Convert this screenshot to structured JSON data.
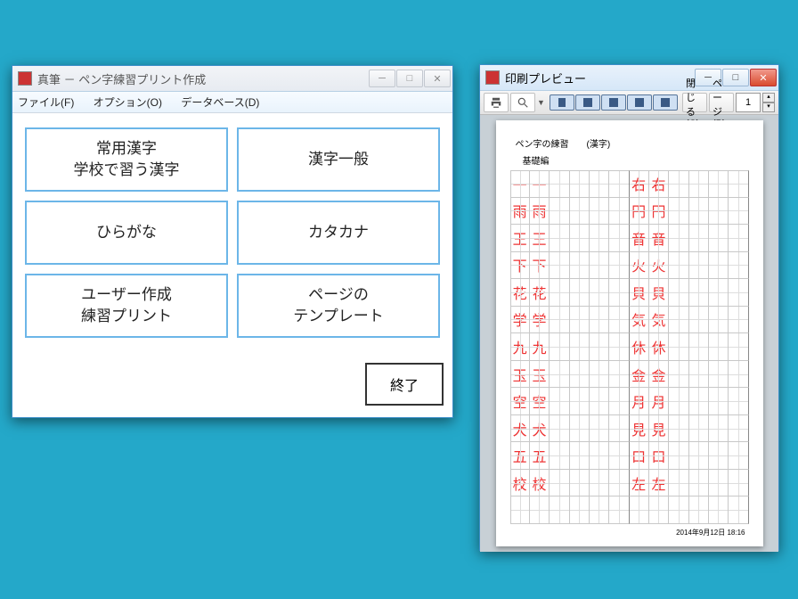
{
  "main_window": {
    "title": "真筆 － ペン字練習プリント作成",
    "menu": {
      "file": "ファイル(F)",
      "options": "オプション(O)",
      "database": "データベース(D)"
    },
    "buttons": {
      "joyo": "常用漢字\n学校で習う漢字",
      "kanji_general": "漢字一般",
      "hiragana": "ひらがな",
      "katakana": "カタカナ",
      "user_print": "ユーザー作成\n練習プリント",
      "page_template": "ページの\nテンプレート",
      "exit": "終了"
    }
  },
  "preview_window": {
    "title": "印刷プレビュー",
    "toolbar": {
      "close": "閉じる(C)",
      "page": "ページ(P)",
      "page_value": "1"
    },
    "page": {
      "head_left": "ペン字の練習",
      "head_right": "(漢字)",
      "sub": "基礎編",
      "footer": "2014年9月12日 18:16",
      "cols_with_chars": [
        0,
        1,
        6,
        7
      ],
      "sep_after_cols": [
        5,
        11
      ],
      "left_chars": [
        "一",
        "雨",
        "王",
        "下",
        "花",
        "学",
        "九",
        "玉",
        "空",
        "犬",
        "五",
        "校",
        ""
      ],
      "right_chars": [
        "右",
        "円",
        "音",
        "火",
        "貝",
        "気",
        "休",
        "金",
        "月",
        "見",
        "口",
        "左",
        ""
      ]
    }
  }
}
